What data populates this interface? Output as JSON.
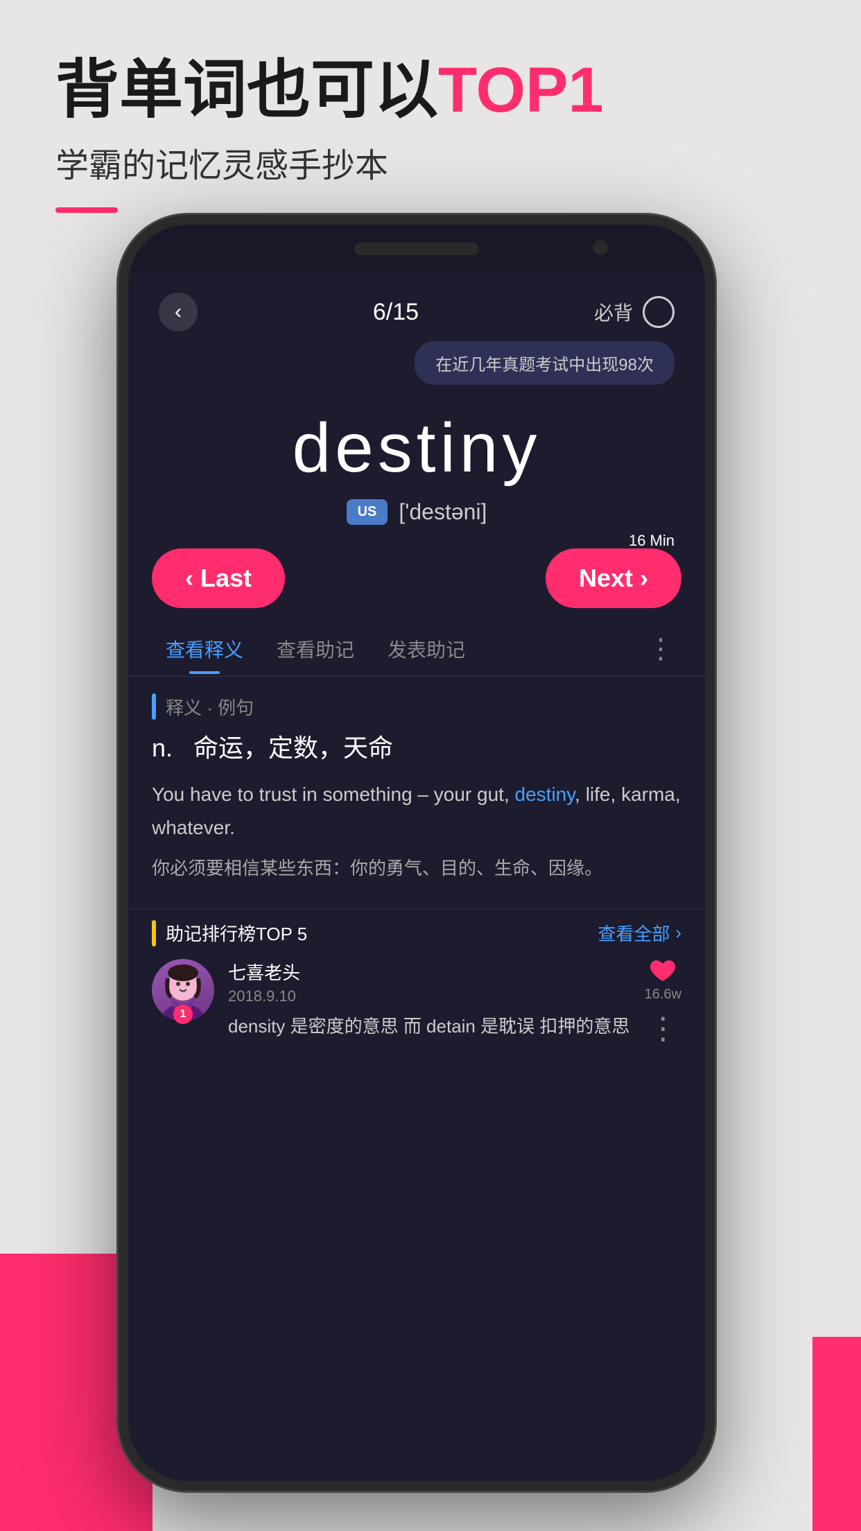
{
  "page": {
    "background": "#e8e5e5"
  },
  "header": {
    "title_part1": "背单词也可以",
    "title_highlight": "TOP1",
    "subtitle": "学霸的记忆灵感手抄本",
    "underline_color": "#ff2d6e"
  },
  "phone": {
    "screen": {
      "header": {
        "back_icon": "‹",
        "progress": "6/15",
        "bookmark_label": "必背",
        "bookmark_circle": true
      },
      "tooltip": {
        "text": "在近几年真题考试中出现98次"
      },
      "word": {
        "text": "destiny",
        "pronunciation_badge": "US",
        "phonetic": "['destəni]"
      },
      "nav": {
        "time": "16 Min",
        "last_label": "‹ Last",
        "next_label": "Next ›"
      },
      "tabs": [
        {
          "label": "查看释义",
          "active": true
        },
        {
          "label": "查看助记",
          "active": false
        },
        {
          "label": "发表助记",
          "active": false
        }
      ],
      "tab_more": "⋮",
      "definition": {
        "section_label": "释义 · 例句",
        "pos": "n.",
        "meaning": "命运，定数，天命",
        "example_en_before": "You have to trust in something – your gut, ",
        "example_en_word": "destiny",
        "example_en_after": ", life, karma, whatever.",
        "example_zh": "你必须要相信某些东西：你的勇气、目的、生命、因缘。"
      },
      "mnemonic": {
        "section_label": "助记排行榜TOP 5",
        "see_all": "查看全部",
        "user": {
          "name": "七喜老头",
          "date": "2018.9.10",
          "rank": "1",
          "likes": "16.6w",
          "content": "density 是密度的意思 而 detain 是耽误 扣押的意思"
        }
      }
    }
  }
}
